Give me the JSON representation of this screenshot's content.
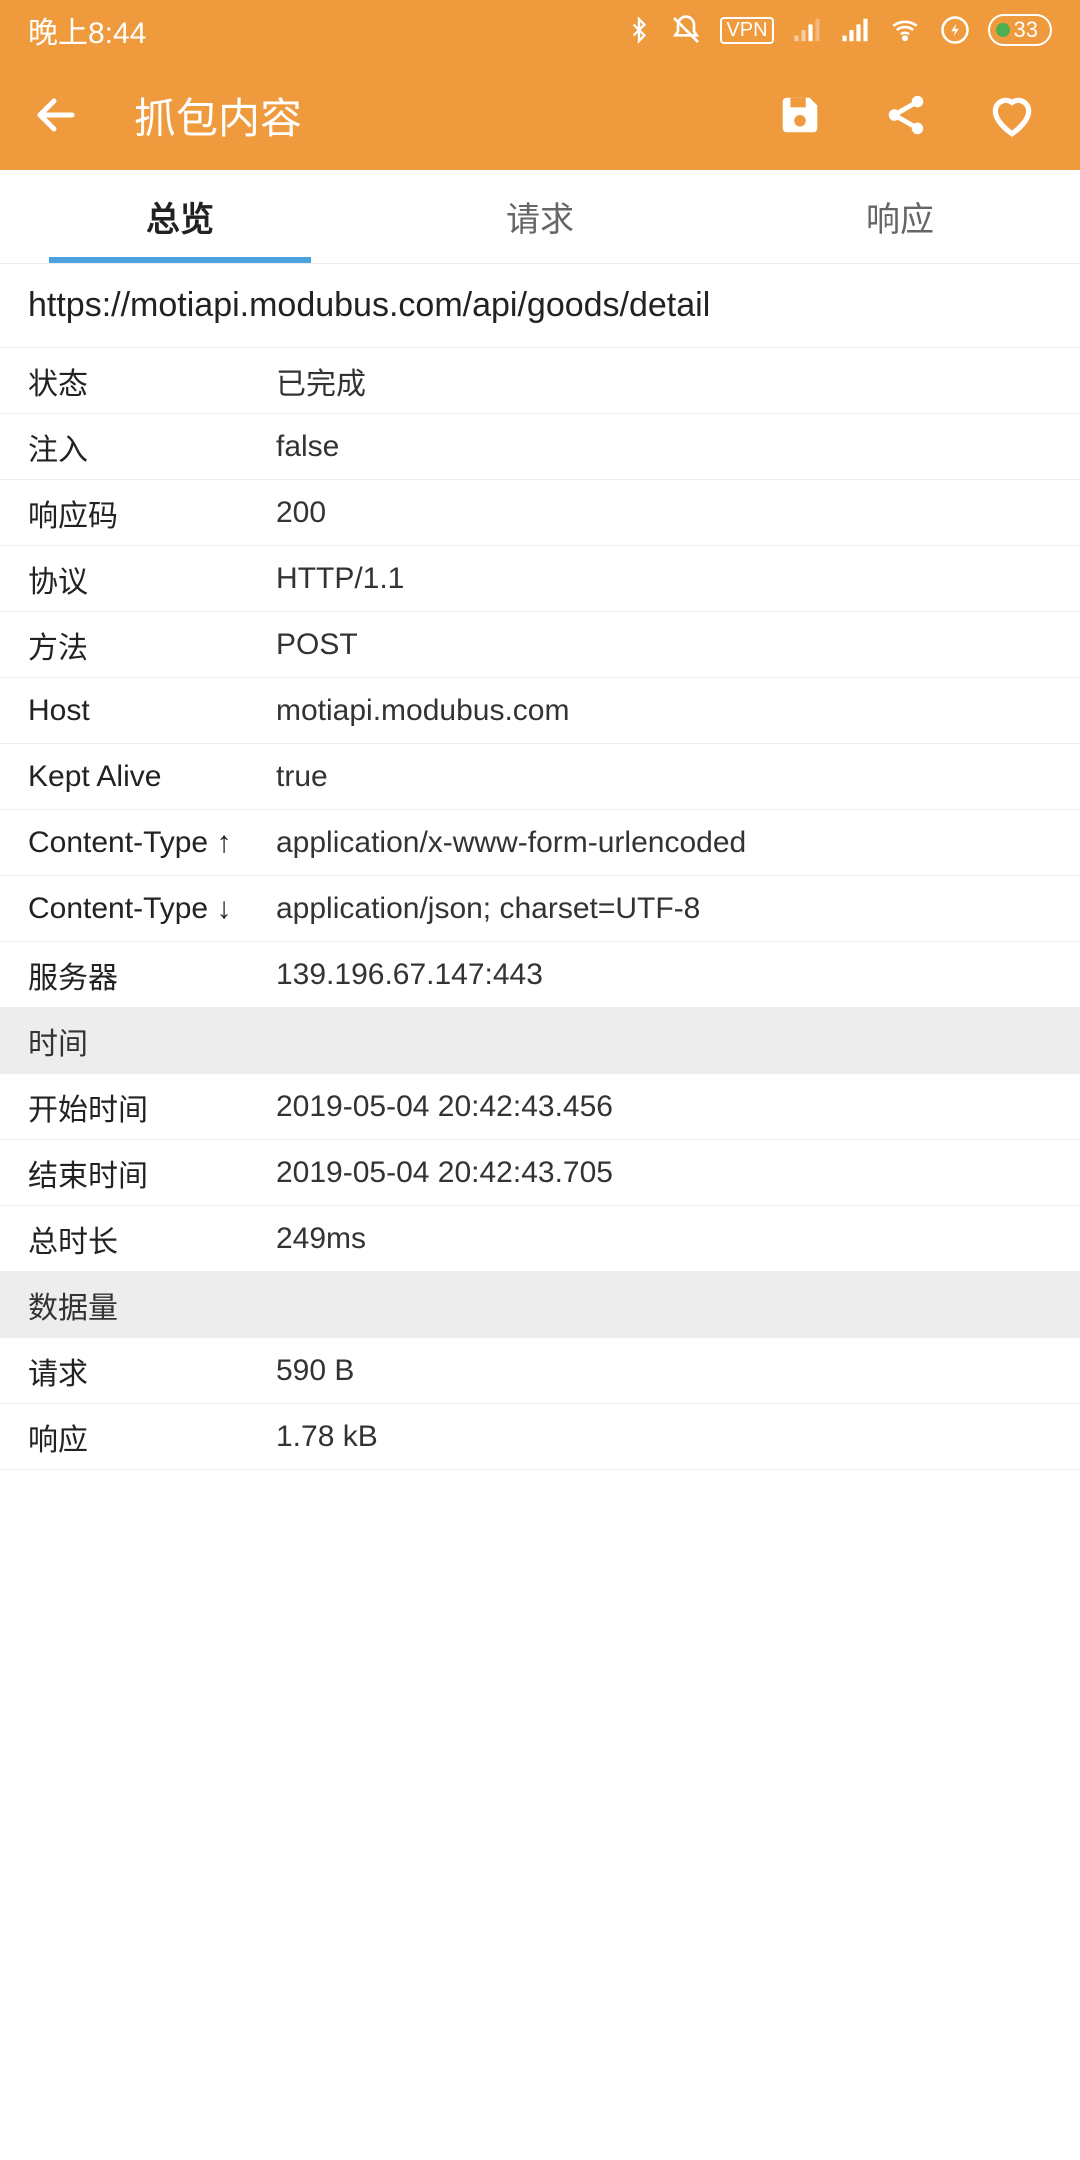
{
  "status_bar": {
    "time": "晚上8:44",
    "battery": "33"
  },
  "app_bar": {
    "title": "抓包内容"
  },
  "tabs": {
    "overview": "总览",
    "request": "请求",
    "response": "响应"
  },
  "url": "https://motiapi.modubus.com/api/goods/detail",
  "rows": {
    "status": {
      "label": "状态",
      "value": "已完成"
    },
    "inject": {
      "label": "注入",
      "value": "false"
    },
    "code": {
      "label": "响应码",
      "value": "200"
    },
    "protocol": {
      "label": "协议",
      "value": "HTTP/1.1"
    },
    "method": {
      "label": "方法",
      "value": "POST"
    },
    "host": {
      "label": "Host",
      "value": "motiapi.modubus.com"
    },
    "kept_alive": {
      "label": "Kept Alive",
      "value": "true"
    },
    "ct_up": {
      "label": "Content-Type ↑",
      "value": "application/x-www-form-urlencoded"
    },
    "ct_down": {
      "label": "Content-Type ↓",
      "value": "application/json; charset=UTF-8"
    },
    "server": {
      "label": "服务器",
      "value": "139.196.67.147:443"
    }
  },
  "time_section": {
    "header": "时间",
    "start": {
      "label": "开始时间",
      "value": "2019-05-04 20:42:43.456"
    },
    "end": {
      "label": "结束时间",
      "value": "2019-05-04 20:42:43.705"
    },
    "total": {
      "label": "总时长",
      "value": "249ms"
    }
  },
  "data_section": {
    "header": "数据量",
    "request": {
      "label": "请求",
      "value": "590 B"
    },
    "response": {
      "label": "响应",
      "value": "1.78 kB"
    }
  }
}
